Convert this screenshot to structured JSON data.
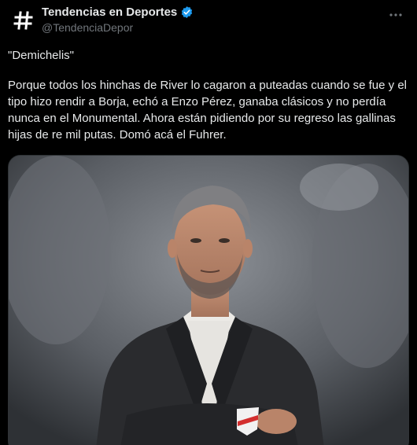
{
  "account": {
    "display_name": "Tendencias en Deportes",
    "handle": "@TendenciaDepor",
    "avatar_icon": "hashtag-icon",
    "verified_icon": "verified-badge-icon",
    "verified_color": "#1d9bf0"
  },
  "tweet": {
    "quote": "\"Demichelis\"",
    "body": "Porque todos los hinchas de River lo cagaron a puteadas cuando se fue y el tipo hizo rendir a Borja, echó a Enzo Pérez, ganaba clásicos y no perdía nunca en el Monumental. Ahora están pidiendo por su regreso las gallinas hijas de re mil putas. Domó acá el Fuhrer."
  },
  "actions": {
    "more_icon": "more-options-icon"
  },
  "colors": {
    "background": "#000000",
    "text": "#e7e9ea",
    "muted": "#71767b",
    "border": "#2f3336"
  }
}
